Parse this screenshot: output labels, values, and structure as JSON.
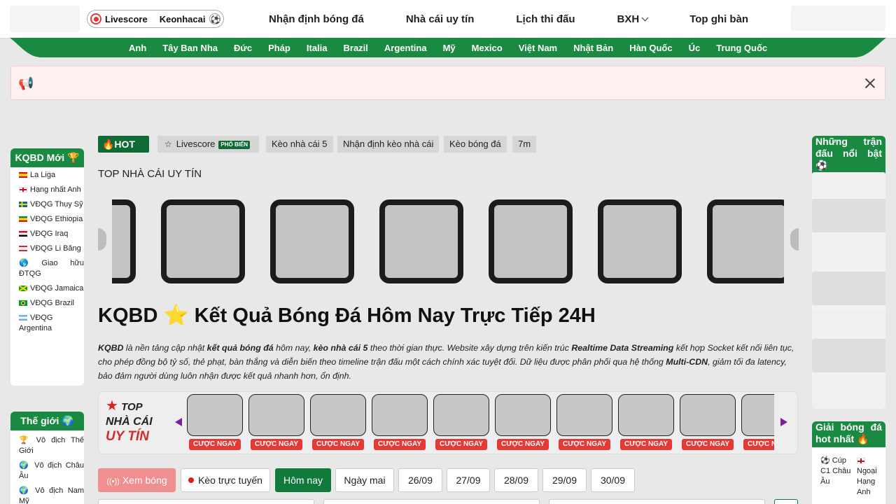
{
  "header": {
    "brand_primary": "Livescore",
    "brand_secondary": "Keonhacai",
    "nav": [
      {
        "label": "Nhận định bóng đá"
      },
      {
        "label": "Nhà cái uy tín"
      },
      {
        "label": "Lịch thi đấu"
      },
      {
        "label": "BXH"
      },
      {
        "label": "Top ghi bàn"
      }
    ]
  },
  "countries": [
    "Anh",
    "Tây Ban Nha",
    "Đức",
    "Pháp",
    "Italia",
    "Brazil",
    "Argentina",
    "Mỹ",
    "Mexico",
    "Việt Nam",
    "Nhật Bản",
    "Hàn Quốc",
    "Úc",
    "Trung Quốc"
  ],
  "left_sidebar": {
    "new_results": {
      "title": "KQBD Mới 🏆",
      "items": [
        {
          "label": "La Liga",
          "flag": "spain"
        },
        {
          "label": "Hạng nhất Anh",
          "flag": "england"
        },
        {
          "label": "VĐQG Thụy Sỹ",
          "flag": "sweden"
        },
        {
          "label": "VĐQG Ethiopia",
          "flag": "ethiopia"
        },
        {
          "label": "VĐQG Iraq",
          "flag": "iraq"
        },
        {
          "label": "VĐQG Li Băng",
          "flag": "lebanon"
        },
        {
          "label": "Giao hữu ĐTQG",
          "flag": "globe"
        },
        {
          "label": "VĐQG Jamaica",
          "flag": "jamaica"
        },
        {
          "label": "VĐQG Brazil",
          "flag": "brazil"
        },
        {
          "label": "VĐQG Argentina",
          "flag": "argentina"
        }
      ]
    },
    "world": {
      "title": "Thế giới 🌍",
      "items": [
        {
          "label": "Vô địch Thế Giới",
          "icon": "trophy"
        },
        {
          "label": "Vô địch Châu Âu",
          "icon": "globe"
        },
        {
          "label": "Vô địch Nam Mỹ",
          "icon": "globe"
        }
      ]
    }
  },
  "tags": {
    "hot": "🔥HOT",
    "livescore": "Livescore",
    "livescore_badge": "PHỔ BIẾN",
    "items": [
      "Kèo nhà cái 5",
      "Nhận định kèo nhà cái",
      "Kèo bóng đá",
      "7m"
    ]
  },
  "top_bookmakers_title": "TOP NHÀ CÁI UY TÍN",
  "page_title": "KQBD ⭐ Kết Quả Bóng Đá Hôm Nay Trực Tiếp 24H",
  "intro": {
    "p1_b1": "KQBD",
    "p1_t1": " là nền tảng cập nhật ",
    "p1_b2": "kết quả bóng đá",
    "p1_t2": " hôm nay, ",
    "p1_b3": "kèo nhà cái 5",
    "p1_t3": " theo thời gian thực. Website xây dựng trên kiến trúc ",
    "p1_b4": "Realtime Data Streaming",
    "p1_t4": " kết hợp Socket kết nối liên tục, cho phép đồng bộ tỷ số, thẻ phạt, bàn thắng và diễn biến theo timeline trận đấu một cách chính xác tuyệt đối. Dữ liệu được phân phối qua hệ thống ",
    "p1_b5": "Multi-CDN",
    "p1_t5": ", giảm tối đa latency, bảo đảm người dùng luôn nhận được kết quả nhanh hơn, ổn định."
  },
  "bookmaker_box": {
    "logo_line1": "TOP",
    "logo_line2": "NHÀ CÁI",
    "logo_line3": "UY TÍN",
    "bet_label": "CƯỢC NGAY"
  },
  "filters": {
    "watch": "Xem bóng",
    "live_odds": "Kèo trực tuyến",
    "today": "Hôm nay",
    "tomorrow": "Ngày mai",
    "dates": [
      "26/09",
      "27/09",
      "28/09",
      "29/09",
      "30/09"
    ]
  },
  "right_sidebar": {
    "featured_title": "Những trận đấu nổi bật ⚽",
    "hot_leagues_title": "Giải bóng đá hot nhất 🔥",
    "hot_leagues": [
      {
        "label": "Cúp C1 Châu Âu",
        "icon": "ball"
      },
      {
        "label": "Ngoại Hạng Anh",
        "icon": "england"
      }
    ]
  },
  "colors": {
    "brand_green": "#1a8a42",
    "dark_green": "#0f6b35",
    "bet_red": "#e53935",
    "live_red": "#e01e1e",
    "arrow_purple": "#7b1fa2"
  }
}
